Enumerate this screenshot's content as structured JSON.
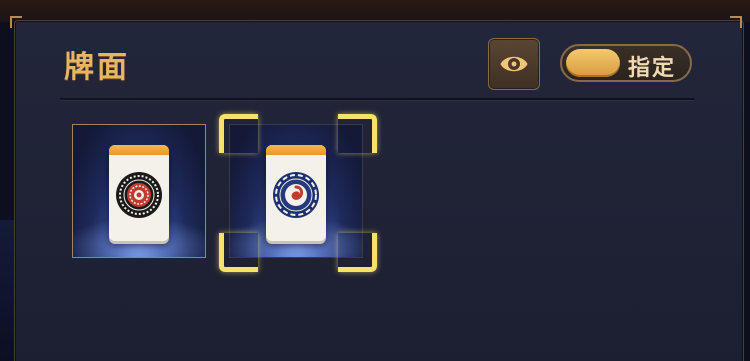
{
  "panel": {
    "title": "牌面"
  },
  "controls": {
    "eye_icon": "eye-icon",
    "toggle_label": "指定",
    "toggle_on": true
  },
  "tiles": [
    {
      "name": "circle-tile-mandala",
      "selected": false
    },
    {
      "name": "circle-tile-swirl",
      "selected": true
    }
  ],
  "colors": {
    "accent_gold": "#e8b661",
    "selection_yellow": "#f5e16b",
    "tile_cap_orange": "#e49a2a",
    "panel_bg": "#1f2235"
  }
}
